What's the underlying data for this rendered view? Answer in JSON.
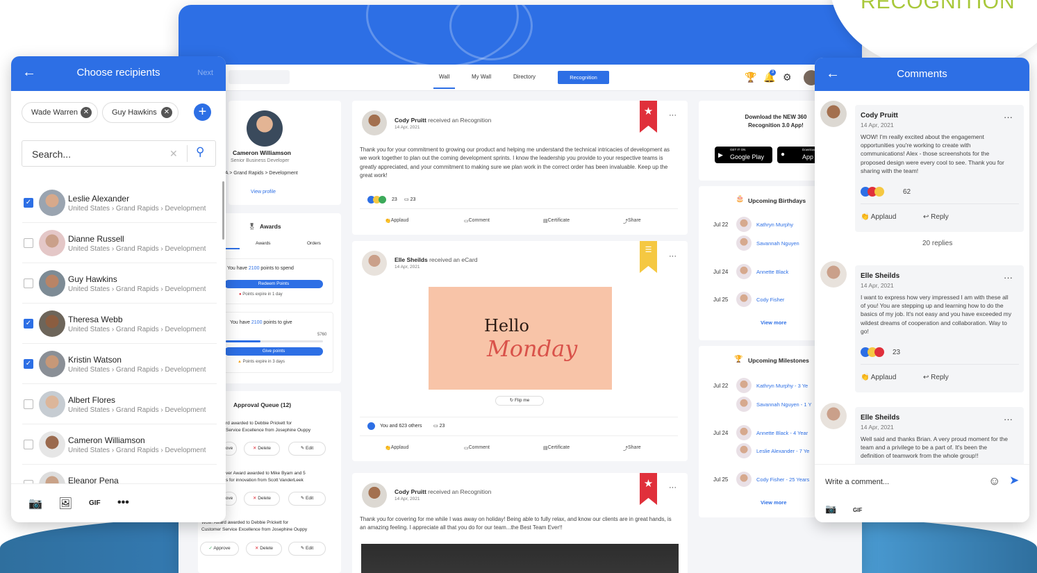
{
  "brand": {
    "text": "RECOGNITION"
  },
  "main": {
    "nav": {
      "tabs": [
        "Wall",
        "My Wall",
        "Directory"
      ],
      "active_tab": "Wall",
      "recognition_button": "Recognition",
      "notification_count": "3"
    },
    "profile": {
      "name": "Cameron Williamson",
      "title": "Senior Business Developer",
      "path": "A > Grand Rapids > Development",
      "view_profile": "View profile"
    },
    "awards": {
      "title": "Awards",
      "tabs": [
        "Awards",
        "Orders"
      ],
      "spend_text_pre": "You have ",
      "spend_points": "2100",
      "spend_text_post": " points to spend",
      "redeem_button": "Redeem Points",
      "expire_1": "Points expire in 1 day",
      "give_text_pre": "You have ",
      "give_points": "2100",
      "give_text_post": " points to give",
      "give_max": "5760",
      "give_fraction": 0.36,
      "give_button": "Give points",
      "expire_2": "Points expire in 3 days"
    },
    "approval": {
      "title": "Approval Queue (12)",
      "items": [
        {
          "line1": "rd awarded to Debbie Prickett for",
          "line2": "Service Excellence from Josephine Ouppy"
        },
        {
          "line1": "ver Award awarded to Mike Byam and 5",
          "line2": "s for innovation from Scott VanderLeek"
        },
        {
          "line1": "Wow! Award awarded to Debbie Prickett for",
          "line2": "Customer Service Excellence from Josephine Ouppy"
        }
      ],
      "approve": "ove",
      "approve_full": "Approve",
      "delete": "Delete",
      "edit": "Edit"
    },
    "posts": [
      {
        "author": "Cody Pruitt",
        "action": " received an Recognition",
        "date": "14 Apr, 2021",
        "text": "Thank you for your commitment to growing our product and helping me understand the technical intricacies of development as we work together to plan out the coming development sprints.  I know the leadership you provide to your respective teams is greatly appreciated, and your commitment to making sure we plan work in the correct order has been invaluable.  Keep up the great work!",
        "reactions": "23",
        "comments": "23"
      },
      {
        "author": "Elle Sheilds",
        "action": " received an eCard",
        "date": "14 Apr, 2021",
        "ecard_line1": "Hello",
        "ecard_line2": "Monday",
        "flip": "Flip me",
        "reactions": "You and 623 others",
        "comments": "23"
      },
      {
        "author": "Cody Pruitt",
        "action": " received an Recognition",
        "date": "14 Apr, 2021",
        "text": "Thank you for covering for me while I was away on holiday! Being able to fully relax, and know our clients are in great hands, is an amazing feeling. I appreciate all that you do for our team...the Best Team Ever!!"
      }
    ],
    "actions": {
      "applaud": "Applaud",
      "comment": "Comment",
      "certificate": "Certificate",
      "share": "Share"
    },
    "download": {
      "title": "Download the NEW 360 Recognition 3.0 App!",
      "google_small": "GET IT ON",
      "google": "Google Play",
      "apple_small": "Download on the",
      "apple": "App S"
    },
    "birthdays": {
      "title": "Upcoming Birthdays",
      "rows": [
        {
          "date": "Jul 22",
          "name": "Kathryn Murphy"
        },
        {
          "date": "",
          "name": "Savannah Nguyen"
        },
        {
          "date": "Jul 24",
          "name": "Annette Black"
        },
        {
          "date": "Jul 25",
          "name": "Cody Fisher"
        }
      ],
      "view_more": "View more"
    },
    "milestones": {
      "title": "Upcoming Milestones",
      "rows": [
        {
          "date": "Jul 22",
          "name": "Kathryn Murphy - 3 Ye"
        },
        {
          "date": "",
          "name": "Savannah Nguyen - 1 Y"
        },
        {
          "date": "Jul 24",
          "name": "Annette Black - 4 Year"
        },
        {
          "date": "",
          "name": "Leslie Alexander - 7 Ye"
        },
        {
          "date": "Jul 25",
          "name": "Cody Fisher - 25 Years"
        }
      ],
      "view_more": "View more"
    }
  },
  "recipients": {
    "title": "Choose recipients",
    "next": "Next",
    "chips": [
      "Wade Warren",
      "Guy Hawkins"
    ],
    "search_placeholder": "Search...",
    "people": [
      {
        "name": "Leslie Alexander",
        "path": "United States › Grand Rapids › Development",
        "checked": true
      },
      {
        "name": "Dianne Russell",
        "path": "United States › Grand Rapids › Development",
        "checked": false
      },
      {
        "name": "Guy Hawkins",
        "path": "United States › Grand Rapids › Development",
        "checked": false
      },
      {
        "name": "Theresa Webb",
        "path": "United States › Grand Rapids › Development",
        "checked": true
      },
      {
        "name": "Kristin Watson",
        "path": "United States › Grand Rapids › Development",
        "checked": true
      },
      {
        "name": "Albert Flores",
        "path": "United States › Grand Rapids › Development",
        "checked": false
      },
      {
        "name": "Cameron Williamson",
        "path": "United States › Grand Rapids › Development",
        "checked": false
      },
      {
        "name": "Eleanor Pena",
        "path": "",
        "checked": false
      }
    ],
    "footer": {
      "gif": "GIF"
    }
  },
  "comments": {
    "title": "Comments",
    "items": [
      {
        "name": "Cody Pruitt",
        "date": "14 Apr, 2021",
        "text": "WOW! I'm really excited about the engagement opportunities you're working to create with communications! Alex - those screenshots for the proposed design were every cool to see. Thank you for sharing with the team!",
        "reactions": "62"
      },
      {
        "name": "Elle Sheilds",
        "date": "14 Apr, 2021",
        "text": "I want to express how very impressed I am with these all of you! You are stepping up and learning how to do the basics of my job. It's not easy and you have exceeded my wildest dreams of cooperation and collaboration. Way to go!",
        "reactions": "23"
      },
      {
        "name": "Elle Sheilds",
        "date": "14 Apr, 2021",
        "text": "Well said and thanks Brian. A very proud moment for the team and a privilege to be a part of. It's been the definition of teamwork from the whole group!!"
      }
    ],
    "replies": "20 replies",
    "applaud": "Applaud",
    "reply": "Reply",
    "write_placeholder": "Write a comment...",
    "gif": "GIF"
  },
  "colors": {
    "accent": "#2d6fe5",
    "brand_green": "#a8c83a",
    "bookmark_red": "#e0303b",
    "bookmark_yellow": "#f5c842"
  }
}
